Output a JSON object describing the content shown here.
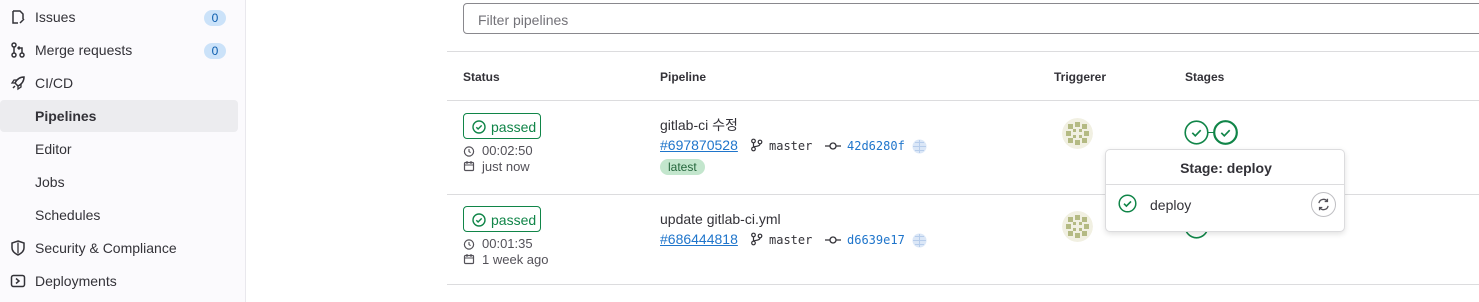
{
  "sidebar": {
    "items": [
      {
        "label": "Issues",
        "icon": "issues-icon",
        "badge": "0"
      },
      {
        "label": "Merge requests",
        "icon": "merge-request-icon",
        "badge": "0"
      },
      {
        "label": "CI/CD",
        "icon": "rocket-icon"
      },
      {
        "label": "Pipelines",
        "active": true
      },
      {
        "label": "Editor"
      },
      {
        "label": "Jobs"
      },
      {
        "label": "Schedules"
      },
      {
        "label": "Security & Compliance",
        "icon": "shield-icon"
      },
      {
        "label": "Deployments",
        "icon": "deployments-icon"
      }
    ]
  },
  "filter": {
    "placeholder": "Filter pipelines"
  },
  "table": {
    "headers": [
      "Status",
      "Pipeline",
      "Triggerer",
      "Stages"
    ],
    "rows": [
      {
        "status": "passed",
        "duration": "00:02:50",
        "finished": "just now",
        "title": "gitlab-ci 수정",
        "id": "#697870528",
        "branch": "master",
        "sha": "42d6280f",
        "tag": "latest"
      },
      {
        "status": "passed",
        "duration": "00:01:35",
        "finished": "1 week ago",
        "title": "update gitlab-ci.yml",
        "id": "#686444818",
        "branch": "master",
        "sha": "d6639e17"
      }
    ]
  },
  "popover": {
    "title": "Stage: deploy",
    "job": "deploy",
    "retry_icon": "retry-icon"
  },
  "colors": {
    "success": "#108548",
    "link": "#1f75cb",
    "badge_bg": "#cbe2f9",
    "latest_bg": "#c3e6cd"
  }
}
